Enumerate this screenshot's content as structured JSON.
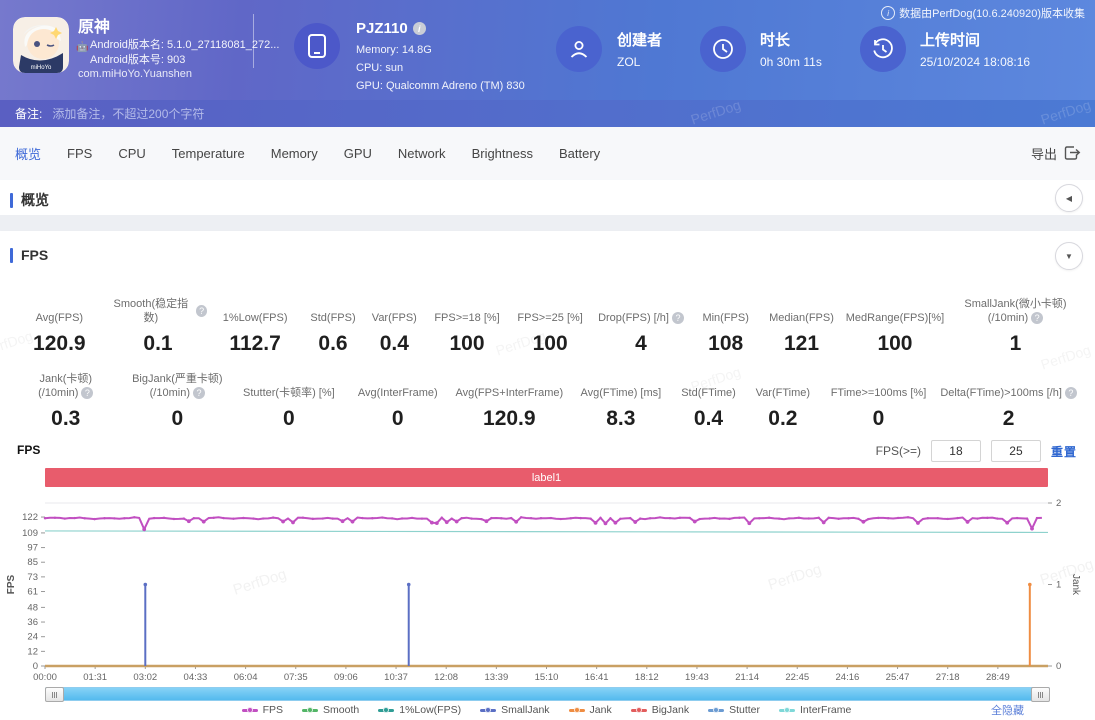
{
  "header": {
    "collector_note": "数据由PerfDog(10.6.240920)版本收集",
    "app": {
      "title": "原神",
      "android_version_name": "Android版本名: 5.1.0_27118081_272...",
      "android_version_code": "Android版本号: 903",
      "package": "com.miHoYo.Yuanshen",
      "icon_brand": "miHoYo"
    },
    "device": {
      "name": "PJZ110",
      "memory": "Memory: 14.8G",
      "cpu": "CPU: sun",
      "gpu": "GPU: Qualcomm Adreno (TM) 830"
    },
    "meta": [
      {
        "icon": "user-icon",
        "label": "创建者",
        "value": "ZOL"
      },
      {
        "icon": "clock-icon",
        "label": "时长",
        "value": "0h 30m 11s"
      },
      {
        "icon": "history-icon",
        "label": "上传时间",
        "value": "25/10/2024 18:08:16"
      }
    ]
  },
  "remark": {
    "label": "备注:",
    "placeholder": "添加备注，不超过200个字符"
  },
  "tabs": {
    "items": [
      "概览",
      "FPS",
      "CPU",
      "Temperature",
      "Memory",
      "GPU",
      "Network",
      "Brightness",
      "Battery"
    ],
    "active": "概览",
    "export_label": "导出"
  },
  "overview_section": {
    "title": "概览"
  },
  "fps_section": {
    "title": "FPS",
    "chart_corner_title": "FPS",
    "threshold": {
      "label": "FPS(>=)",
      "low": "18",
      "high": "25",
      "reset_label": "重置"
    },
    "hide_all_label": "全隐藏",
    "stats_row1": [
      {
        "label": "Avg(FPS)",
        "value": "120.9"
      },
      {
        "label": "Smooth(稳定指数)",
        "value": "0.1",
        "help": true
      },
      {
        "label": "1%Low(FPS)",
        "value": "112.7"
      },
      {
        "label": "Std(FPS)",
        "value": "0.6"
      },
      {
        "label": "Var(FPS)",
        "value": "0.4"
      },
      {
        "label": "FPS>=18 [%]",
        "value": "100"
      },
      {
        "label": "FPS>=25 [%]",
        "value": "100"
      },
      {
        "label": "Drop(FPS) [/h]",
        "value": "4",
        "help": true
      },
      {
        "label": "Min(FPS)",
        "value": "108"
      },
      {
        "label": "Median(FPS)",
        "value": "121"
      },
      {
        "label": "MedRange(FPS)[%]",
        "value": "100"
      },
      {
        "label": "SmallJank(微小卡顿)",
        "label2": "(/10min)",
        "value": "1",
        "help": true
      }
    ],
    "stats_row2": [
      {
        "label": "Jank(卡顿)",
        "label2": "(/10min)",
        "value": "0.3",
        "help": true
      },
      {
        "label": "BigJank(严重卡顿)",
        "label2": "(/10min)",
        "value": "0",
        "help": true
      },
      {
        "label": "Stutter(卡顿率) [%]",
        "value": "0"
      },
      {
        "label": "Avg(InterFrame)",
        "value": "0"
      },
      {
        "label": "Avg(FPS+InterFrame)",
        "value": "120.9"
      },
      {
        "label": "Avg(FTime) [ms]",
        "value": "8.3"
      },
      {
        "label": "Std(FTime)",
        "value": "0.4"
      },
      {
        "label": "Var(FTime)",
        "value": "0.2"
      },
      {
        "label": "FTime>=100ms [%]",
        "value": "0"
      },
      {
        "label": "Delta(FTime)>100ms [/h]",
        "value": "2",
        "help": true
      }
    ]
  },
  "chart_data": {
    "type": "line",
    "title": "label1",
    "left_axis": {
      "label": "FPS",
      "ticks": [
        0,
        12,
        24,
        36,
        48,
        61,
        73,
        85,
        97,
        109,
        122
      ],
      "max": 133.5
    },
    "right_axis": {
      "label": "Jank",
      "ticks": [
        0,
        1,
        2
      ],
      "max": 2
    },
    "x_ticks": [
      "00:00",
      "01:31",
      "03:02",
      "04:33",
      "06:04",
      "07:35",
      "09:06",
      "10:37",
      "12:08",
      "13:39",
      "15:10",
      "16:41",
      "18:12",
      "19:43",
      "21:14",
      "22:45",
      "24:16",
      "25:47",
      "27:18",
      "28:49"
    ],
    "x_tick_interval_s": 91,
    "duration_s": 1820,
    "grid": false,
    "legend_position": "bottom",
    "series": [
      {
        "name": "FPS",
        "color": "#c14fc1",
        "kind": "noisy-line",
        "axis": "left",
        "baseline": 121,
        "dips": [
          [
            182,
            112
          ],
          [
            260,
            118.6
          ],
          [
            292,
            118.2
          ],
          [
            430,
            118.3
          ],
          [
            447,
            117.6
          ],
          [
            540,
            118.6
          ],
          [
            560,
            118.2
          ],
          [
            698,
            117.4
          ],
          [
            714,
            117.0
          ],
          [
            728,
            117.8
          ],
          [
            745,
            118.3
          ],
          [
            800,
            118.6
          ],
          [
            858,
            118.1
          ],
          [
            1000,
            117.2
          ],
          [
            1018,
            116.8
          ],
          [
            1036,
            117.3
          ],
          [
            1072,
            117.9
          ],
          [
            1180,
            118.3
          ],
          [
            1276,
            116.9
          ],
          [
            1410,
            117.6
          ],
          [
            1486,
            118.1
          ],
          [
            1588,
            117.1
          ],
          [
            1678,
            118.0
          ],
          [
            1742,
            117.3
          ],
          [
            1787,
            112.5
          ]
        ]
      },
      {
        "name": "Smooth",
        "color": "#53b567",
        "kind": "flat",
        "axis": "left",
        "value": 0.1
      },
      {
        "name": "1%Low(FPS)",
        "color": "#2f9d95",
        "line_color": "#8ed2cd",
        "kind": "trend",
        "axis": "left",
        "start": 110.6,
        "end": 109.4
      },
      {
        "name": "SmallJank",
        "color": "#5b6fc4",
        "kind": "spike",
        "axis": "right",
        "events": [
          [
            182,
            1
          ],
          [
            660,
            1
          ]
        ]
      },
      {
        "name": "Jank",
        "color": "#ef8d43",
        "kind": "spike",
        "axis": "right",
        "events": [
          [
            1787,
            1
          ]
        ]
      },
      {
        "name": "BigJank",
        "color": "#e25d5d",
        "kind": "spike",
        "axis": "right",
        "events": []
      },
      {
        "name": "Stutter",
        "color": "#6b9bd2",
        "kind": "flat",
        "axis": "left",
        "value": 0
      },
      {
        "name": "InterFrame",
        "color": "#7fd8d8",
        "kind": "flat",
        "axis": "left",
        "value": 0
      }
    ],
    "watermark": "PerfDog"
  }
}
